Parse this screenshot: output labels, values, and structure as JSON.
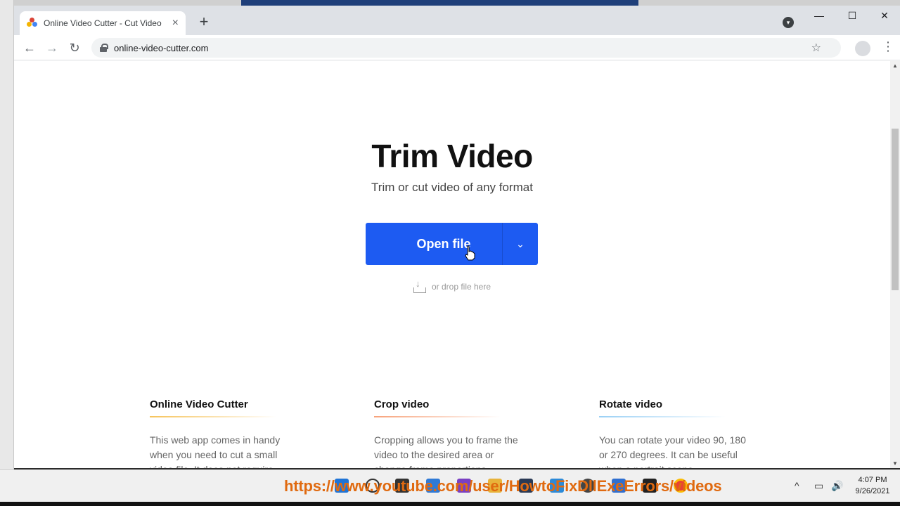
{
  "browser": {
    "tab_title": "Online Video Cutter - Cut Video",
    "tab_close": "×",
    "new_tab": "+",
    "url": "online-video-cutter.com",
    "back": "←",
    "forward": "→",
    "reload": "↻",
    "bookmark_star": "☆",
    "menu": "⋮",
    "minimize": "—",
    "maximize": "☐",
    "close": "✕"
  },
  "hero": {
    "title": "Trim Video",
    "subtitle": "Trim or cut video of any format",
    "open_button": "Open file",
    "dropdown_caret": "⌄",
    "drop_hint": "or drop file here"
  },
  "features": [
    {
      "title": "Online Video Cutter",
      "text": "This web app comes in handy when you need to cut a small video file. It does not require"
    },
    {
      "title": "Crop video",
      "text": "Cropping allows you to frame the video to the desired area or change frame proportions."
    },
    {
      "title": "Rotate video",
      "text": "You can rotate your video 90, 180 or 270 degrees. It can be useful when a portrait scene"
    }
  ],
  "taskbar": {
    "overlay_text": "https://www.youtube.com/user/HowtoFixDllExeErrors/videos",
    "time": "4:07 PM",
    "date": "9/26/2021",
    "tray_up": "^",
    "volume": "🔊"
  },
  "colors": {
    "accent": "#1d5bf2",
    "overlay": "#e06a10"
  }
}
